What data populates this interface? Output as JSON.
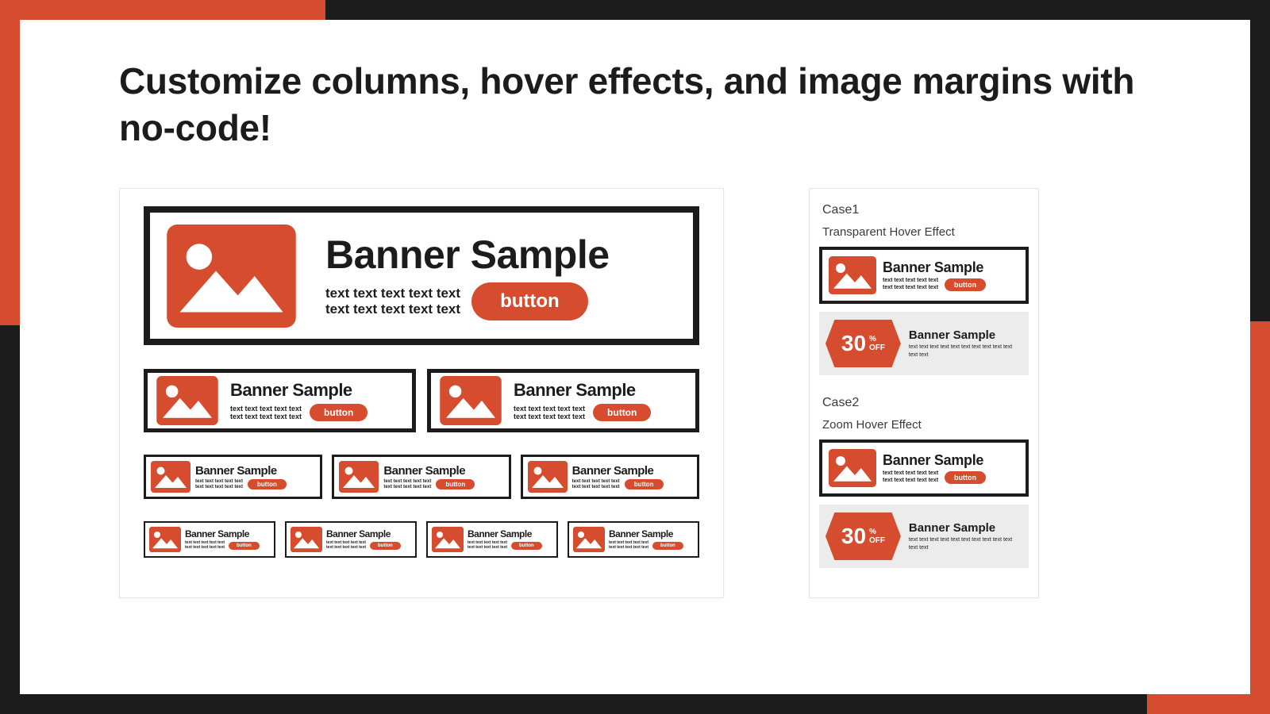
{
  "title": "Customize columns, hover effects, and image margins with no-code!",
  "banner": {
    "title": "Banner Sample",
    "text": "text text text text text\ntext text text text text",
    "button": "button"
  },
  "cases": {
    "case1": {
      "label": "Case1",
      "subtitle": "Transparent Hover Effect"
    },
    "case2": {
      "label": "Case2",
      "subtitle": "Zoom Hover Effect"
    }
  },
  "promo": {
    "discount_num": "30",
    "discount_pct": "%",
    "discount_off": "OFF",
    "title": "Banner Sample",
    "text": "text text text text text text text text text text text text"
  },
  "colors": {
    "accent": "#d54c2e",
    "ink": "#1c1c1c"
  }
}
